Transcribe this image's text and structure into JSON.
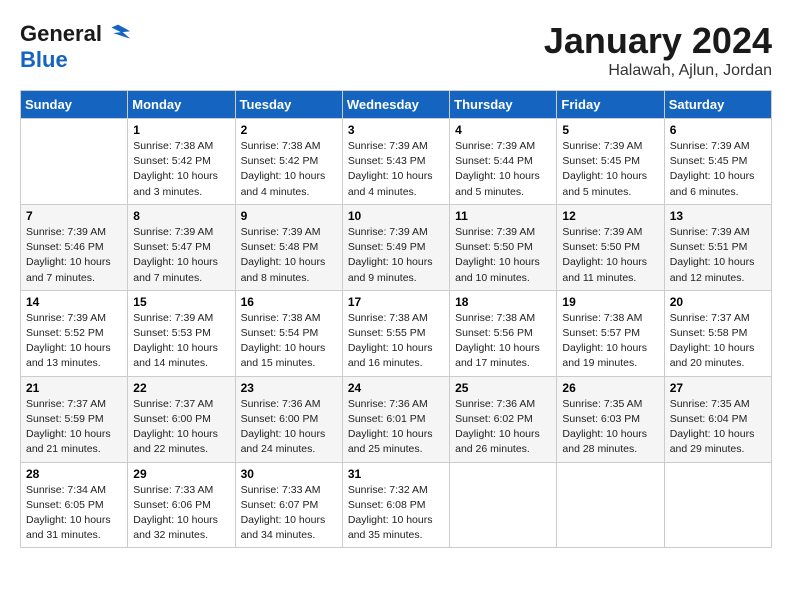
{
  "header": {
    "logo_line1": "General",
    "logo_line2": "Blue",
    "month": "January 2024",
    "location": "Halawah, Ajlun, Jordan"
  },
  "columns": [
    "Sunday",
    "Monday",
    "Tuesday",
    "Wednesday",
    "Thursday",
    "Friday",
    "Saturday"
  ],
  "weeks": [
    [
      {
        "day": "",
        "info": ""
      },
      {
        "day": "1",
        "info": "Sunrise: 7:38 AM\nSunset: 5:42 PM\nDaylight: 10 hours\nand 3 minutes."
      },
      {
        "day": "2",
        "info": "Sunrise: 7:38 AM\nSunset: 5:42 PM\nDaylight: 10 hours\nand 4 minutes."
      },
      {
        "day": "3",
        "info": "Sunrise: 7:39 AM\nSunset: 5:43 PM\nDaylight: 10 hours\nand 4 minutes."
      },
      {
        "day": "4",
        "info": "Sunrise: 7:39 AM\nSunset: 5:44 PM\nDaylight: 10 hours\nand 5 minutes."
      },
      {
        "day": "5",
        "info": "Sunrise: 7:39 AM\nSunset: 5:45 PM\nDaylight: 10 hours\nand 5 minutes."
      },
      {
        "day": "6",
        "info": "Sunrise: 7:39 AM\nSunset: 5:45 PM\nDaylight: 10 hours\nand 6 minutes."
      }
    ],
    [
      {
        "day": "7",
        "info": "Sunrise: 7:39 AM\nSunset: 5:46 PM\nDaylight: 10 hours\nand 7 minutes."
      },
      {
        "day": "8",
        "info": "Sunrise: 7:39 AM\nSunset: 5:47 PM\nDaylight: 10 hours\nand 7 minutes."
      },
      {
        "day": "9",
        "info": "Sunrise: 7:39 AM\nSunset: 5:48 PM\nDaylight: 10 hours\nand 8 minutes."
      },
      {
        "day": "10",
        "info": "Sunrise: 7:39 AM\nSunset: 5:49 PM\nDaylight: 10 hours\nand 9 minutes."
      },
      {
        "day": "11",
        "info": "Sunrise: 7:39 AM\nSunset: 5:50 PM\nDaylight: 10 hours\nand 10 minutes."
      },
      {
        "day": "12",
        "info": "Sunrise: 7:39 AM\nSunset: 5:50 PM\nDaylight: 10 hours\nand 11 minutes."
      },
      {
        "day": "13",
        "info": "Sunrise: 7:39 AM\nSunset: 5:51 PM\nDaylight: 10 hours\nand 12 minutes."
      }
    ],
    [
      {
        "day": "14",
        "info": "Sunrise: 7:39 AM\nSunset: 5:52 PM\nDaylight: 10 hours\nand 13 minutes."
      },
      {
        "day": "15",
        "info": "Sunrise: 7:39 AM\nSunset: 5:53 PM\nDaylight: 10 hours\nand 14 minutes."
      },
      {
        "day": "16",
        "info": "Sunrise: 7:38 AM\nSunset: 5:54 PM\nDaylight: 10 hours\nand 15 minutes."
      },
      {
        "day": "17",
        "info": "Sunrise: 7:38 AM\nSunset: 5:55 PM\nDaylight: 10 hours\nand 16 minutes."
      },
      {
        "day": "18",
        "info": "Sunrise: 7:38 AM\nSunset: 5:56 PM\nDaylight: 10 hours\nand 17 minutes."
      },
      {
        "day": "19",
        "info": "Sunrise: 7:38 AM\nSunset: 5:57 PM\nDaylight: 10 hours\nand 19 minutes."
      },
      {
        "day": "20",
        "info": "Sunrise: 7:37 AM\nSunset: 5:58 PM\nDaylight: 10 hours\nand 20 minutes."
      }
    ],
    [
      {
        "day": "21",
        "info": "Sunrise: 7:37 AM\nSunset: 5:59 PM\nDaylight: 10 hours\nand 21 minutes."
      },
      {
        "day": "22",
        "info": "Sunrise: 7:37 AM\nSunset: 6:00 PM\nDaylight: 10 hours\nand 22 minutes."
      },
      {
        "day": "23",
        "info": "Sunrise: 7:36 AM\nSunset: 6:00 PM\nDaylight: 10 hours\nand 24 minutes."
      },
      {
        "day": "24",
        "info": "Sunrise: 7:36 AM\nSunset: 6:01 PM\nDaylight: 10 hours\nand 25 minutes."
      },
      {
        "day": "25",
        "info": "Sunrise: 7:36 AM\nSunset: 6:02 PM\nDaylight: 10 hours\nand 26 minutes."
      },
      {
        "day": "26",
        "info": "Sunrise: 7:35 AM\nSunset: 6:03 PM\nDaylight: 10 hours\nand 28 minutes."
      },
      {
        "day": "27",
        "info": "Sunrise: 7:35 AM\nSunset: 6:04 PM\nDaylight: 10 hours\nand 29 minutes."
      }
    ],
    [
      {
        "day": "28",
        "info": "Sunrise: 7:34 AM\nSunset: 6:05 PM\nDaylight: 10 hours\nand 31 minutes."
      },
      {
        "day": "29",
        "info": "Sunrise: 7:33 AM\nSunset: 6:06 PM\nDaylight: 10 hours\nand 32 minutes."
      },
      {
        "day": "30",
        "info": "Sunrise: 7:33 AM\nSunset: 6:07 PM\nDaylight: 10 hours\nand 34 minutes."
      },
      {
        "day": "31",
        "info": "Sunrise: 7:32 AM\nSunset: 6:08 PM\nDaylight: 10 hours\nand 35 minutes."
      },
      {
        "day": "",
        "info": ""
      },
      {
        "day": "",
        "info": ""
      },
      {
        "day": "",
        "info": ""
      }
    ]
  ]
}
